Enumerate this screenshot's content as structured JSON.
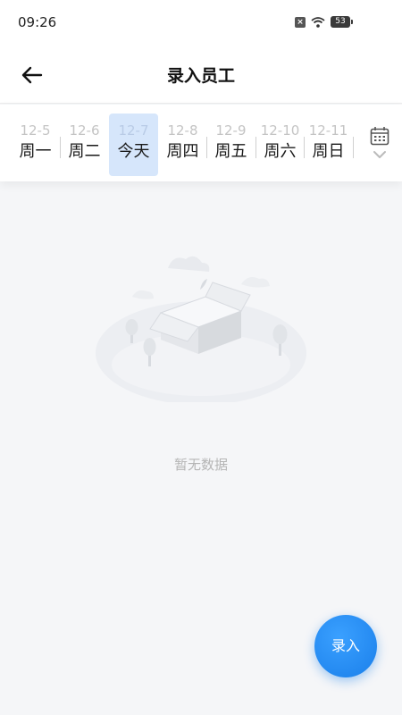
{
  "status_bar": {
    "time": "09:26",
    "battery": "53"
  },
  "header": {
    "title": "录入员工"
  },
  "date_strip": {
    "days": [
      {
        "date": "12-5",
        "week": "周一"
      },
      {
        "date": "12-6",
        "week": "周二"
      },
      {
        "date": "12-7",
        "week": "今天",
        "selected": true
      },
      {
        "date": "12-8",
        "week": "周四"
      },
      {
        "date": "12-9",
        "week": "周五"
      },
      {
        "date": "12-10",
        "week": "周六"
      },
      {
        "date": "12-11",
        "week": "周日"
      }
    ]
  },
  "empty_state": {
    "text": "暂无数据"
  },
  "fab": {
    "label": "录入"
  },
  "colors": {
    "accent": "#1a7fea",
    "selected_bg": "#d6e6fb"
  }
}
